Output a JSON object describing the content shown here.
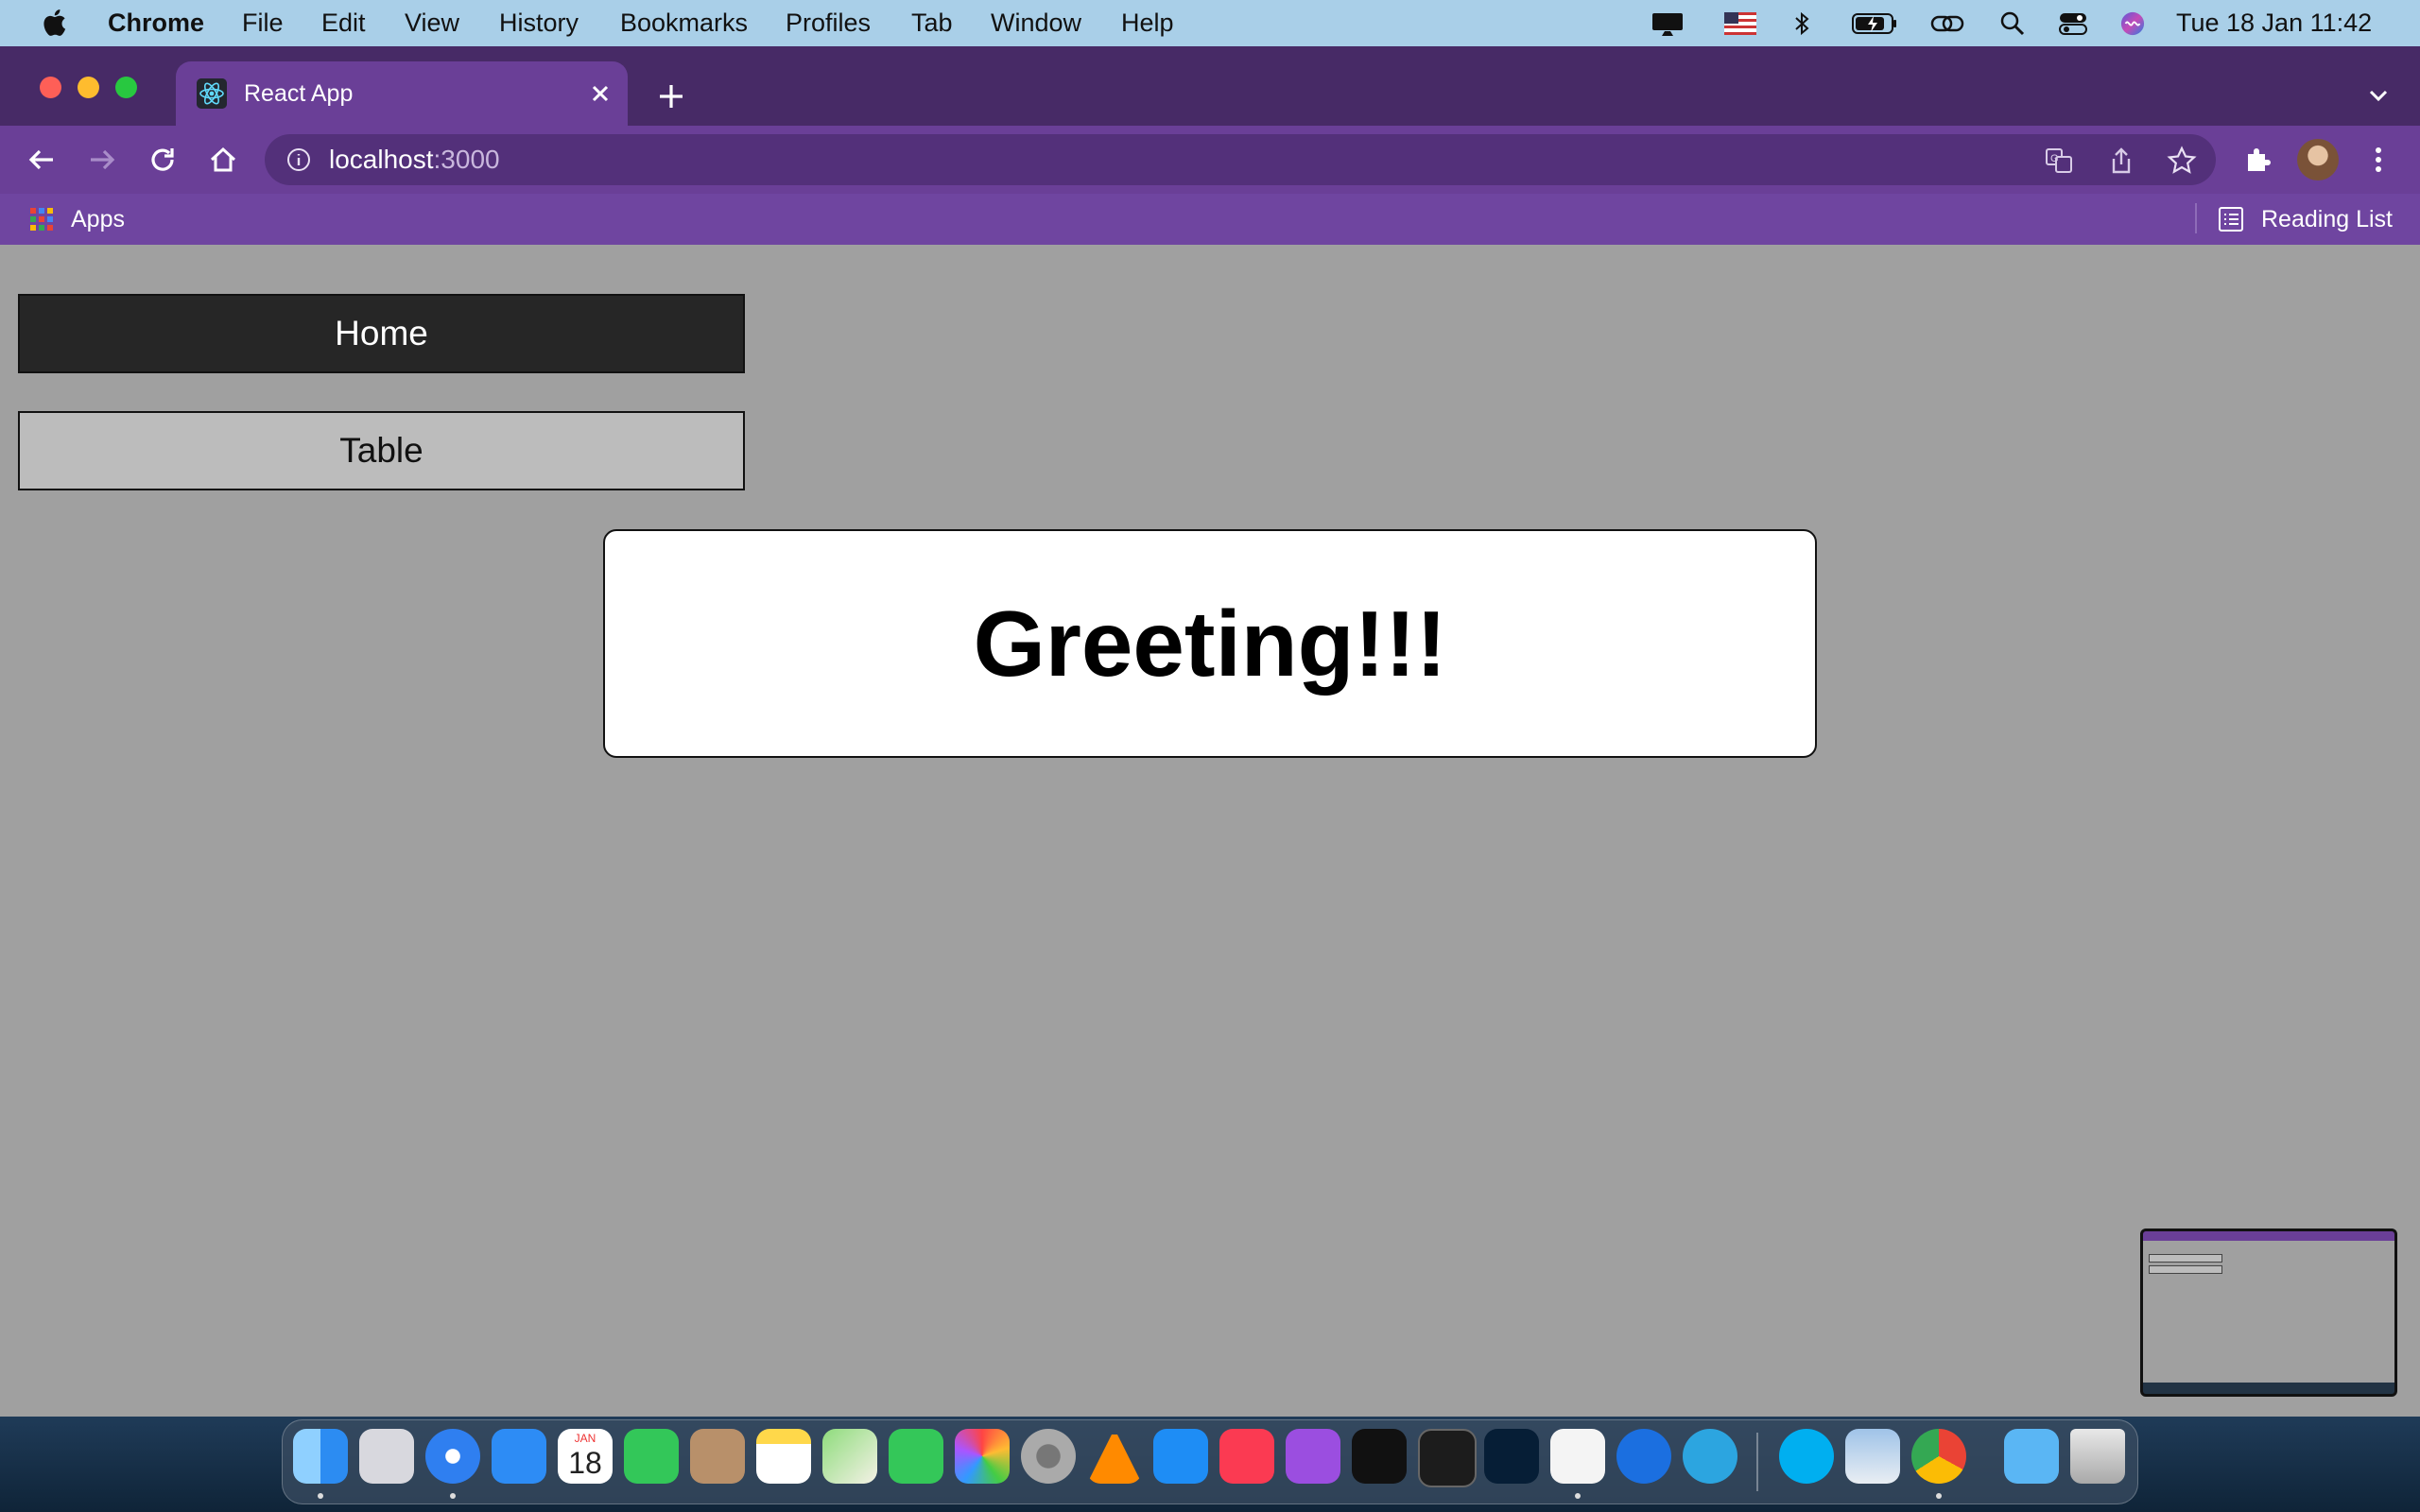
{
  "menubar": {
    "app_name": "Chrome",
    "items": [
      "File",
      "Edit",
      "View",
      "History",
      "Bookmarks",
      "Profiles",
      "Tab",
      "Window",
      "Help"
    ],
    "datetime": "Tue 18 Jan  11:42"
  },
  "browser": {
    "tab_title": "React App",
    "url_host": "localhost",
    "url_port": ":3000",
    "bookmarks": {
      "apps_label": "Apps",
      "reading_list_label": "Reading List"
    }
  },
  "page": {
    "nav_buttons": {
      "home": "Home",
      "table": "Table"
    },
    "greeting": "Greeting!!!"
  },
  "dock": {
    "calendar_month": "JAN",
    "calendar_day": "18",
    "apps": [
      "Finder",
      "Launchpad",
      "Safari",
      "Mail",
      "Calendar",
      "FaceTime",
      "Contacts",
      "Notes",
      "Maps",
      "Messages",
      "Photos",
      "System Preferences",
      "VLC",
      "App Store",
      "Music",
      "Podcasts",
      "TV",
      "Terminal",
      "Photoshop",
      "Visual Studio Code",
      "Xcode",
      "Telegram",
      "Skype",
      "Preview",
      "Google Chrome",
      "Downloads",
      "Trash"
    ]
  },
  "colors": {
    "menubar": "#a9cfe8",
    "tabstrip": "#472a66",
    "toolbar": "#6a3f97",
    "page_background": "#a0a0a0",
    "home_button": "#262626",
    "table_button": "#bcbcbc"
  }
}
